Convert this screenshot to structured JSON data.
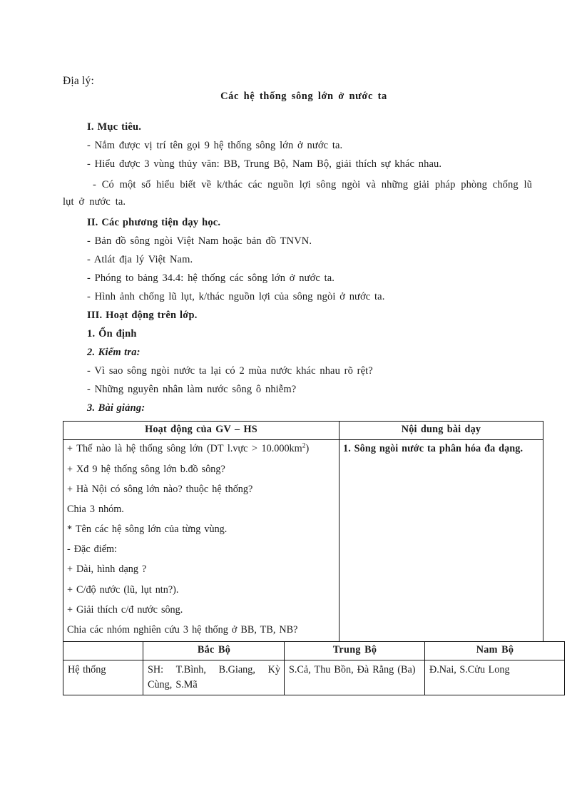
{
  "document": {
    "subject": "Địa lý:",
    "title": "Các hệ thống sông lớn ở nước ta",
    "sections": {
      "objectives_heading": "I. Mục tiêu.",
      "objectives": [
        "- Nắm được vị trí tên gọi 9 hệ thống sông lớn ở nước ta.",
        "- Hiểu được 3 vùng thủy văn: BB, Trung Bộ, Nam Bộ, giải thích sự khác nhau.",
        "- Có một số hiểu biết về k/thác các nguồn lợi sông ngòi và những giải pháp phòng chống lũ lụt ở nước ta."
      ],
      "materials_heading": "II. Các phương tiện dạy học.",
      "materials": [
        "- Bản đồ sông ngòi Việt Nam hoặc bản đồ TNVN.",
        "- Atlát địa lý Việt Nam.",
        "- Phóng to bảng 34.4: hệ thống các sông lớn ở nước ta.",
        "- Hình ảnh chống lũ lụt, k/thác nguồn lợi của sông ngòi ở nước ta."
      ],
      "class_heading": "III. Hoạt động trên lớp.",
      "stabilize_heading": "1. Ổn định",
      "check_heading": "2. Kiểm tra:",
      "check_questions": [
        "- Vì sao sông ngòi nước ta lại có 2 mùa nước khác nhau rõ rệt?",
        "- Những nguyên nhân làm nước sông ô nhiễm?"
      ],
      "lesson_heading": "3. Bài giảng:"
    }
  },
  "lesson_table": {
    "headers": [
      "Hoạt động của GV – HS",
      "Nội dung bài dạy"
    ],
    "activity_lines": [
      "+ Thế nào là hệ thống sông lớn (DT l.vực > 10.000km",
      "+ Xđ 9 hệ thống sông lớn b.đồ sông?",
      "+ Hà Nội có sông lớn nào? thuộc hệ thống?",
      "Chia 3 nhóm.",
      "* Tên các hệ sông lớn của từng vùng.",
      "- Đặc điểm:",
      "+ Dài, hình dạng ?",
      "+ C/độ nước (lũ, lụt ntn?).",
      "+ Giải thích c/đ nước sông.",
      "Chia các nhóm nghiên cứu 3 hệ thống ở BB, TB, NB?"
    ],
    "superscript_first_line": "2",
    "first_line_tail": ")",
    "content_lines": [
      "1. Sông ngòi nước ta phân hóa đa dạng."
    ]
  },
  "regions_table": {
    "headers": [
      "",
      "Bắc Bộ",
      "Trung Bộ",
      "Nam Bộ"
    ],
    "rows": [
      {
        "label": "Hệ thống",
        "bac_bo": "SH: T.Bình, B.Giang, Kỳ Cùng, S.Mã",
        "trung_bo": "S.Cả, Thu Bồn, Đà Rằng (Ba)",
        "nam_bo": "Đ.Nai, S.Cửu Long"
      }
    ]
  }
}
